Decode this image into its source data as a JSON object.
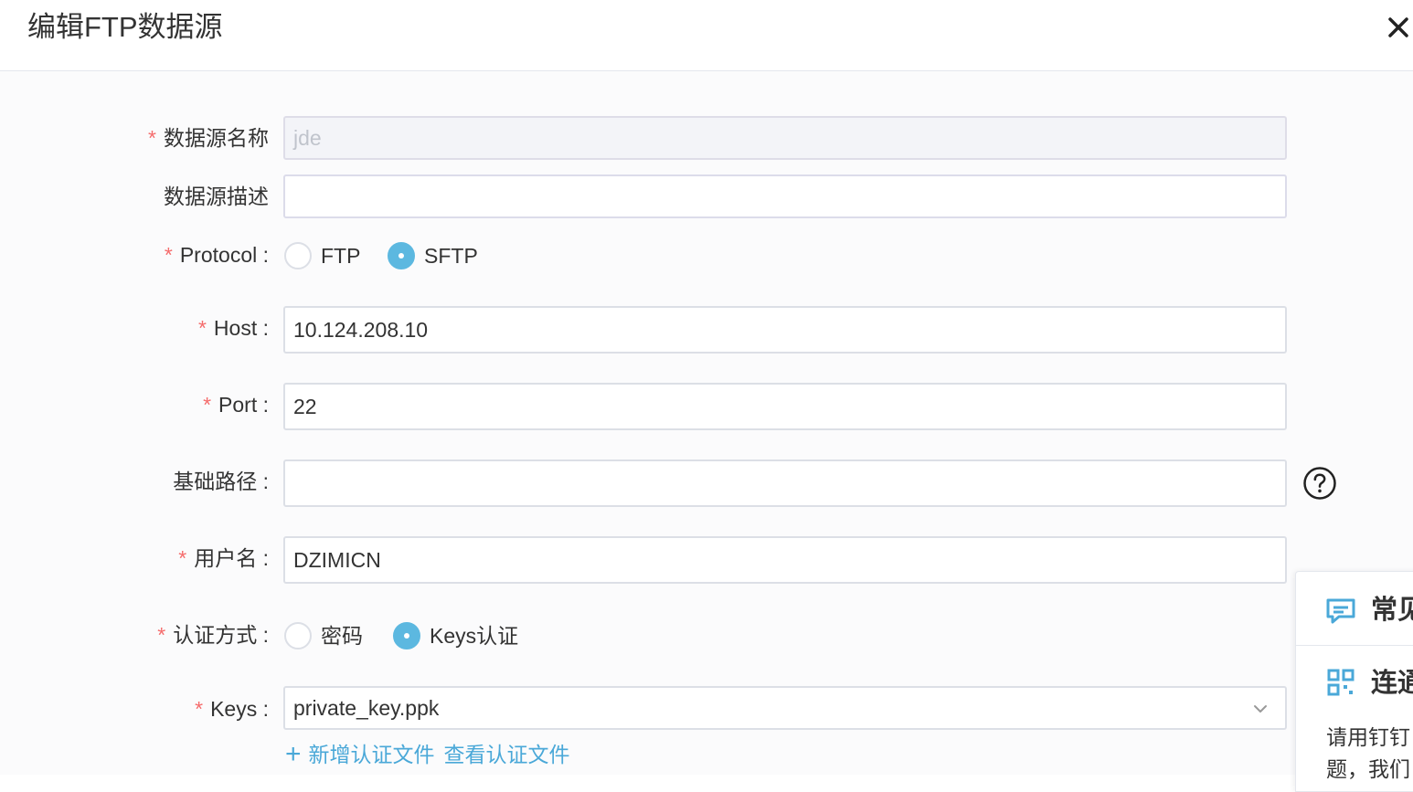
{
  "dialog": {
    "title": "编辑FTP数据源"
  },
  "form": {
    "name": {
      "label": "数据源名称",
      "value": "jde"
    },
    "description": {
      "label": "数据源描述",
      "value": ""
    },
    "protocol": {
      "label": "Protocol :",
      "options": [
        "FTP",
        "SFTP"
      ],
      "selected": "SFTP"
    },
    "host": {
      "label": "Host :",
      "value": "10.124.208.10"
    },
    "port": {
      "label": "Port :",
      "value": "22"
    },
    "base_path": {
      "label": "基础路径 :",
      "value": ""
    },
    "username": {
      "label": "用户名 :",
      "value": "DZIMICN"
    },
    "auth": {
      "label": "认证方式 :",
      "options": [
        "密码",
        "Keys认证"
      ],
      "selected": "Keys认证"
    },
    "keys": {
      "label": "Keys :",
      "value": "private_key.ppk"
    },
    "required_mark": "*",
    "plus": "+",
    "add_key_link": "新增认证文件",
    "view_key_link": "查看认证文件"
  },
  "side_panel": {
    "title1": "常见",
    "title2": "连通",
    "text_line1": "请用钉钉",
    "text_line2": "题，我们"
  },
  "icons": {
    "close": "close-icon",
    "help": "help-circle-icon",
    "dropdown": "chevron-down-icon",
    "panel1": "message-icon",
    "panel2": "qr-grid-icon"
  },
  "colors": {
    "accent": "#5cb8e0",
    "link": "#4aa8d8",
    "required": "#f56c6c"
  }
}
